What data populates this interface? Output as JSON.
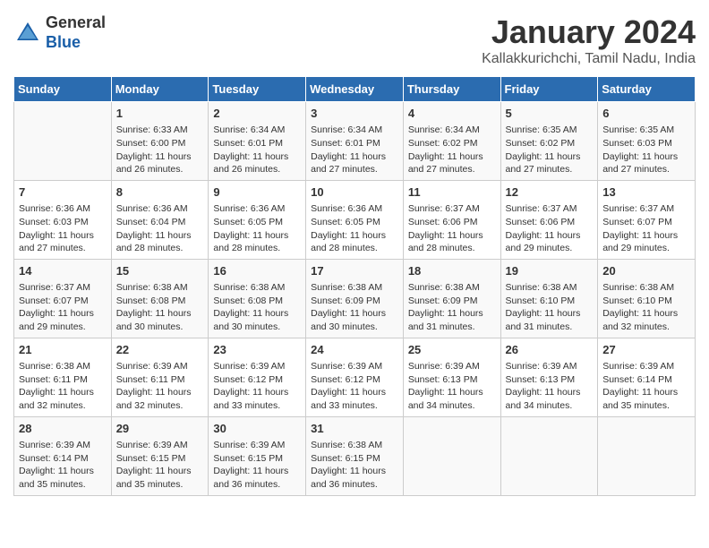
{
  "logo": {
    "general": "General",
    "blue": "Blue"
  },
  "title": "January 2024",
  "subtitle": "Kallakkurichchi, Tamil Nadu, India",
  "days_of_week": [
    "Sunday",
    "Monday",
    "Tuesday",
    "Wednesday",
    "Thursday",
    "Friday",
    "Saturday"
  ],
  "weeks": [
    [
      {
        "day": "",
        "info": ""
      },
      {
        "day": "1",
        "info": "Sunrise: 6:33 AM\nSunset: 6:00 PM\nDaylight: 11 hours\nand 26 minutes."
      },
      {
        "day": "2",
        "info": "Sunrise: 6:34 AM\nSunset: 6:01 PM\nDaylight: 11 hours\nand 26 minutes."
      },
      {
        "day": "3",
        "info": "Sunrise: 6:34 AM\nSunset: 6:01 PM\nDaylight: 11 hours\nand 27 minutes."
      },
      {
        "day": "4",
        "info": "Sunrise: 6:34 AM\nSunset: 6:02 PM\nDaylight: 11 hours\nand 27 minutes."
      },
      {
        "day": "5",
        "info": "Sunrise: 6:35 AM\nSunset: 6:02 PM\nDaylight: 11 hours\nand 27 minutes."
      },
      {
        "day": "6",
        "info": "Sunrise: 6:35 AM\nSunset: 6:03 PM\nDaylight: 11 hours\nand 27 minutes."
      }
    ],
    [
      {
        "day": "7",
        "info": "Sunrise: 6:36 AM\nSunset: 6:03 PM\nDaylight: 11 hours\nand 27 minutes."
      },
      {
        "day": "8",
        "info": "Sunrise: 6:36 AM\nSunset: 6:04 PM\nDaylight: 11 hours\nand 28 minutes."
      },
      {
        "day": "9",
        "info": "Sunrise: 6:36 AM\nSunset: 6:05 PM\nDaylight: 11 hours\nand 28 minutes."
      },
      {
        "day": "10",
        "info": "Sunrise: 6:36 AM\nSunset: 6:05 PM\nDaylight: 11 hours\nand 28 minutes."
      },
      {
        "day": "11",
        "info": "Sunrise: 6:37 AM\nSunset: 6:06 PM\nDaylight: 11 hours\nand 28 minutes."
      },
      {
        "day": "12",
        "info": "Sunrise: 6:37 AM\nSunset: 6:06 PM\nDaylight: 11 hours\nand 29 minutes."
      },
      {
        "day": "13",
        "info": "Sunrise: 6:37 AM\nSunset: 6:07 PM\nDaylight: 11 hours\nand 29 minutes."
      }
    ],
    [
      {
        "day": "14",
        "info": "Sunrise: 6:37 AM\nSunset: 6:07 PM\nDaylight: 11 hours\nand 29 minutes."
      },
      {
        "day": "15",
        "info": "Sunrise: 6:38 AM\nSunset: 6:08 PM\nDaylight: 11 hours\nand 30 minutes."
      },
      {
        "day": "16",
        "info": "Sunrise: 6:38 AM\nSunset: 6:08 PM\nDaylight: 11 hours\nand 30 minutes."
      },
      {
        "day": "17",
        "info": "Sunrise: 6:38 AM\nSunset: 6:09 PM\nDaylight: 11 hours\nand 30 minutes."
      },
      {
        "day": "18",
        "info": "Sunrise: 6:38 AM\nSunset: 6:09 PM\nDaylight: 11 hours\nand 31 minutes."
      },
      {
        "day": "19",
        "info": "Sunrise: 6:38 AM\nSunset: 6:10 PM\nDaylight: 11 hours\nand 31 minutes."
      },
      {
        "day": "20",
        "info": "Sunrise: 6:38 AM\nSunset: 6:10 PM\nDaylight: 11 hours\nand 32 minutes."
      }
    ],
    [
      {
        "day": "21",
        "info": "Sunrise: 6:38 AM\nSunset: 6:11 PM\nDaylight: 11 hours\nand 32 minutes."
      },
      {
        "day": "22",
        "info": "Sunrise: 6:39 AM\nSunset: 6:11 PM\nDaylight: 11 hours\nand 32 minutes."
      },
      {
        "day": "23",
        "info": "Sunrise: 6:39 AM\nSunset: 6:12 PM\nDaylight: 11 hours\nand 33 minutes."
      },
      {
        "day": "24",
        "info": "Sunrise: 6:39 AM\nSunset: 6:12 PM\nDaylight: 11 hours\nand 33 minutes."
      },
      {
        "day": "25",
        "info": "Sunrise: 6:39 AM\nSunset: 6:13 PM\nDaylight: 11 hours\nand 34 minutes."
      },
      {
        "day": "26",
        "info": "Sunrise: 6:39 AM\nSunset: 6:13 PM\nDaylight: 11 hours\nand 34 minutes."
      },
      {
        "day": "27",
        "info": "Sunrise: 6:39 AM\nSunset: 6:14 PM\nDaylight: 11 hours\nand 35 minutes."
      }
    ],
    [
      {
        "day": "28",
        "info": "Sunrise: 6:39 AM\nSunset: 6:14 PM\nDaylight: 11 hours\nand 35 minutes."
      },
      {
        "day": "29",
        "info": "Sunrise: 6:39 AM\nSunset: 6:15 PM\nDaylight: 11 hours\nand 35 minutes."
      },
      {
        "day": "30",
        "info": "Sunrise: 6:39 AM\nSunset: 6:15 PM\nDaylight: 11 hours\nand 36 minutes."
      },
      {
        "day": "31",
        "info": "Sunrise: 6:38 AM\nSunset: 6:15 PM\nDaylight: 11 hours\nand 36 minutes."
      },
      {
        "day": "",
        "info": ""
      },
      {
        "day": "",
        "info": ""
      },
      {
        "day": "",
        "info": ""
      }
    ]
  ]
}
